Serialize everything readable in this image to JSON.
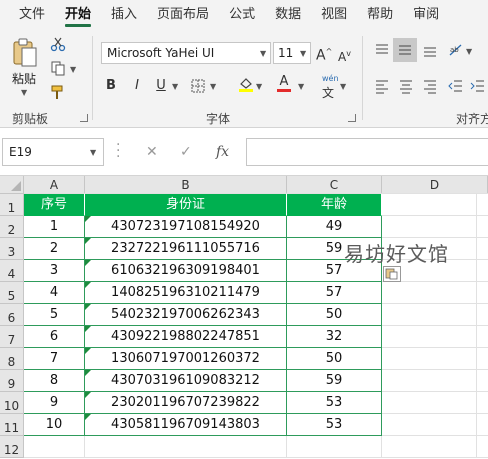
{
  "ribbon": {
    "tabs": [
      {
        "label": "文件",
        "active": false
      },
      {
        "label": "开始",
        "active": true
      },
      {
        "label": "插入",
        "active": false
      },
      {
        "label": "页面布局",
        "active": false
      },
      {
        "label": "公式",
        "active": false
      },
      {
        "label": "数据",
        "active": false
      },
      {
        "label": "视图",
        "active": false
      },
      {
        "label": "帮助",
        "active": false
      },
      {
        "label": "审阅",
        "active": false
      }
    ],
    "clipboard": {
      "paste_label": "粘贴",
      "group_label": "剪贴板"
    },
    "font": {
      "name": "Microsoft YaHei UI",
      "size": "11",
      "group_label": "字体",
      "bold": "B",
      "italic": "I",
      "underline": "U",
      "font_color_letter": "A",
      "phonetic": "wén"
    },
    "alignment": {
      "group_label": "对齐方"
    },
    "accent_color": "#217346",
    "font_color": "#e32b2b",
    "fill_color": "#ffff00"
  },
  "formula_bar": {
    "name_box": "E19",
    "fx_label": "fx",
    "formula": ""
  },
  "sheet": {
    "columns": [
      "A",
      "B",
      "C",
      "D"
    ],
    "rows": [
      "1",
      "2",
      "3",
      "4",
      "5",
      "6",
      "7",
      "8",
      "9",
      "10",
      "11",
      "12"
    ],
    "header": [
      "序号",
      "身份证",
      "年龄"
    ],
    "data": [
      [
        "1",
        "430723197108154920",
        "49"
      ],
      [
        "2",
        "232722196111055716",
        "59"
      ],
      [
        "3",
        "610632196309198401",
        "57"
      ],
      [
        "4",
        "140825196310211479",
        "57"
      ],
      [
        "5",
        "540232197006262343",
        "50"
      ],
      [
        "6",
        "430922198802247851",
        "32"
      ],
      [
        "7",
        "130607197001260372",
        "50"
      ],
      [
        "8",
        "430703196109083212",
        "59"
      ],
      [
        "9",
        "230201196707239822",
        "53"
      ],
      [
        "10",
        "430581196709143803",
        "53"
      ]
    ],
    "header_color": "#00b050",
    "border_color": "#2e9b5b"
  },
  "watermark": "易坊好文馆"
}
